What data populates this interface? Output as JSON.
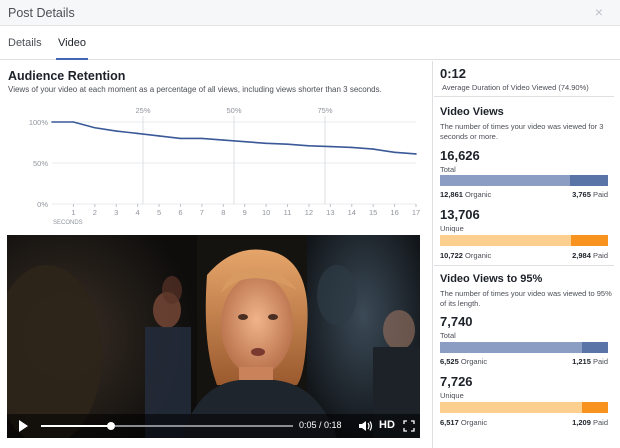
{
  "dialog": {
    "title": "Post Details",
    "close_glyph": "×"
  },
  "tabs": [
    {
      "label": "Details"
    },
    {
      "label": "Video",
      "active": true
    }
  ],
  "retention": {
    "title": "Audience Retention",
    "subtitle": "Views of your video at each moment as a percentage of all views, including views shorter than 3 seconds."
  },
  "chart_data": {
    "type": "line",
    "title": "Audience Retention",
    "x": [
      0,
      1,
      2,
      3,
      4,
      5,
      6,
      7,
      8,
      9,
      10,
      11,
      12,
      13,
      14,
      15,
      16,
      17
    ],
    "x_tick_labels": [
      "1",
      "2",
      "3",
      "4",
      "5",
      "6",
      "7",
      "8",
      "9",
      "10",
      "11",
      "12",
      "13",
      "14",
      "15",
      "16",
      "17"
    ],
    "x_unit_label": "SECONDS",
    "y_ticks": [
      {
        "value": 100,
        "label": "100%"
      },
      {
        "value": 50,
        "label": "50%"
      },
      {
        "value": 0,
        "label": "0%"
      }
    ],
    "ylim": [
      0,
      100
    ],
    "xlim": [
      0,
      17
    ],
    "series": [
      {
        "values": [
          100,
          100,
          93,
          89,
          86,
          83,
          80,
          80,
          78,
          76,
          74,
          73,
          71,
          70,
          69,
          67,
          63,
          61
        ]
      }
    ],
    "quartile_markers": [
      {
        "x": 4.25,
        "label": "25%"
      },
      {
        "x": 8.5,
        "label": "50%"
      },
      {
        "x": 12.75,
        "label": "75%"
      }
    ],
    "line_color": "#3b5998"
  },
  "video": {
    "time": "0:05 / 0:18",
    "progress": 0.2778,
    "hd_label": "HD"
  },
  "avg_duration": {
    "value": "0:12",
    "label": "Average Duration of Video Viewed (74.90%)"
  },
  "views": {
    "title": "Video Views",
    "desc": "The number of times your video was viewed for 3 seconds or more.",
    "total": {
      "value": "16,626",
      "label": "Total",
      "organic": "12,861",
      "organic_label": "Organic",
      "paid": "3,765",
      "paid_label": "Paid",
      "organic_share": 0.7735
    },
    "unique": {
      "value": "13,706",
      "label": "Unique",
      "organic": "10,722",
      "organic_label": "Organic",
      "paid": "2,984",
      "paid_label": "Paid",
      "organic_share": 0.7823
    }
  },
  "views95": {
    "title": "Video Views to 95%",
    "desc": "The number of times your video was viewed to 95% of its length.",
    "total": {
      "value": "7,740",
      "label": "Total",
      "organic": "6,525",
      "organic_label": "Organic",
      "paid": "1,215",
      "paid_label": "Paid",
      "organic_share": 0.843
    },
    "unique": {
      "value": "7,726",
      "label": "Unique",
      "organic": "6,517",
      "organic_label": "Organic",
      "paid": "1,209",
      "paid_label": "Paid",
      "organic_share": 0.8435
    }
  },
  "colors": {
    "blue_organic": "#8b9dc3",
    "blue_paid": "#5b74a8",
    "orange_organic": "#fccf8f",
    "orange_paid": "#f7931e"
  }
}
